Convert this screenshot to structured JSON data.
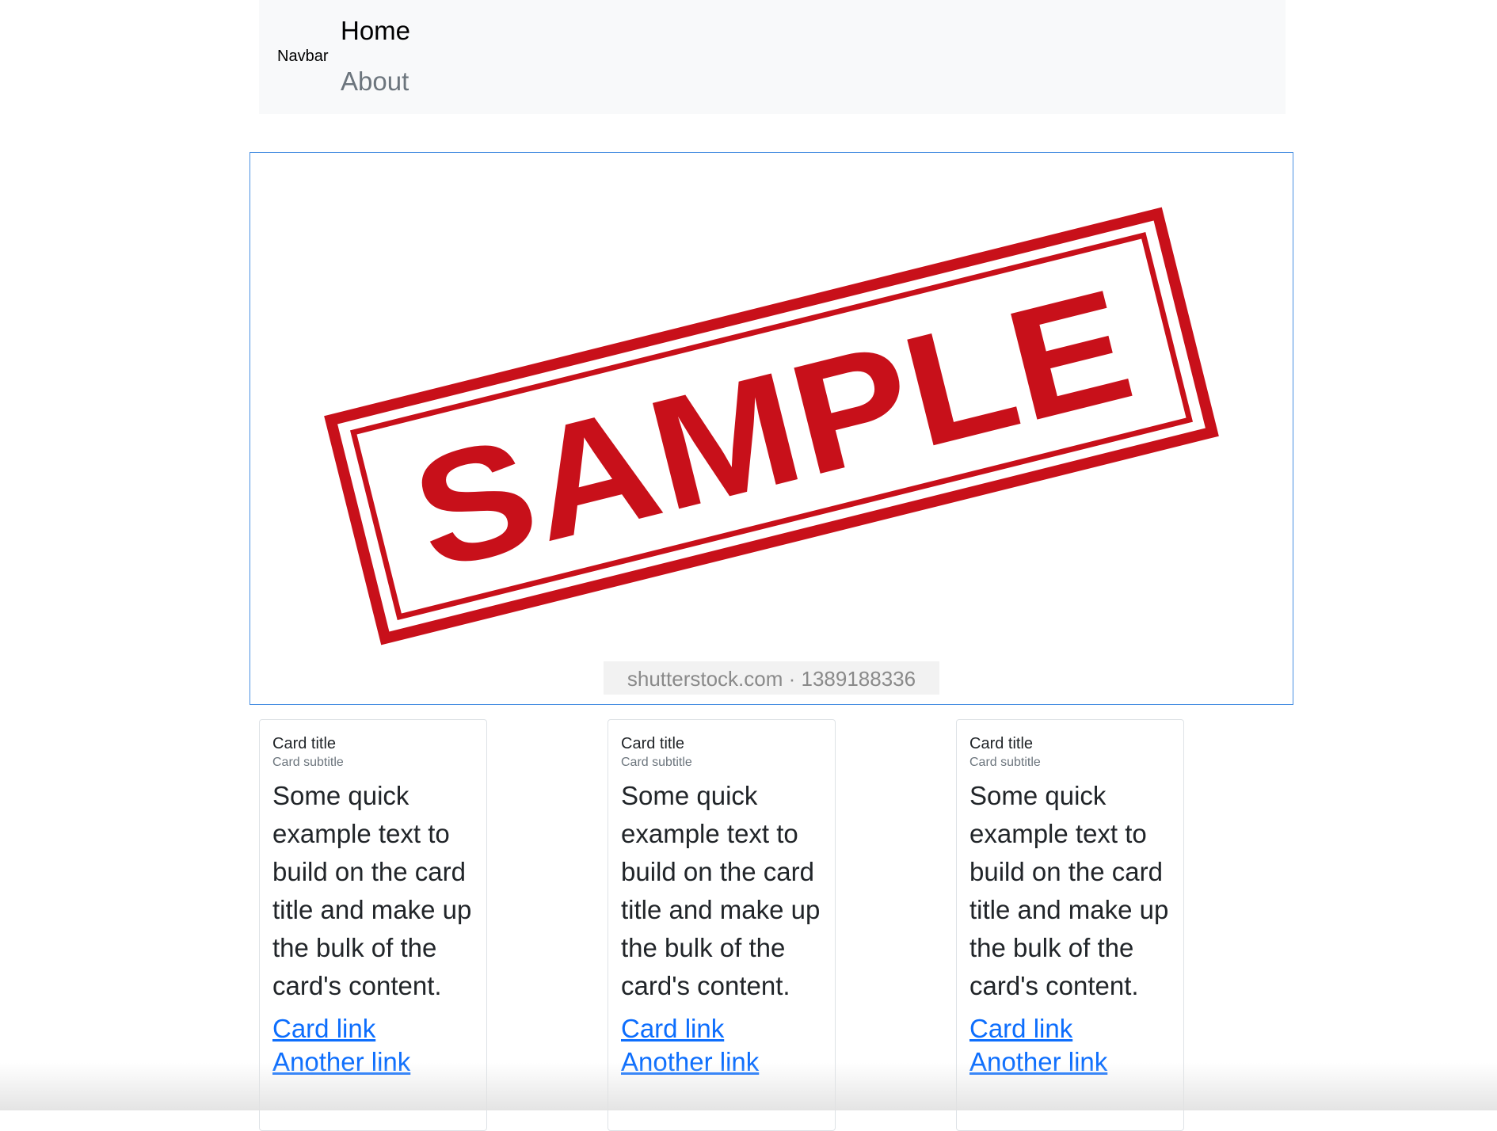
{
  "navbar": {
    "brand": "Navbar",
    "links": [
      {
        "label": "Home",
        "active": true
      },
      {
        "label": "About",
        "active": false
      }
    ]
  },
  "hero": {
    "stamp_text": "SAMPLE",
    "watermark": "shutterstock.com · 1389188336",
    "stamp_color": "#c8101a",
    "border_color": "#4a90e2"
  },
  "cards": [
    {
      "title": "Card title",
      "subtitle": "Card subtitle",
      "text": "Some quick example text to build on the card title and make up the bulk of the card's content.",
      "link1": "Card link",
      "link2": "Another link"
    },
    {
      "title": "Card title",
      "subtitle": "Card subtitle",
      "text": "Some quick example text to build on the card title and make up the bulk of the card's content.",
      "link1": "Card link",
      "link2": "Another link"
    },
    {
      "title": "Card title",
      "subtitle": "Card subtitle",
      "text": "Some quick example text to build on the card title and make up the bulk of the card's content.",
      "link1": "Card link",
      "link2": "Another link"
    }
  ],
  "colors": {
    "link": "#0d6efd",
    "muted": "#6c757d",
    "navbar_bg": "#f8f9fa"
  }
}
